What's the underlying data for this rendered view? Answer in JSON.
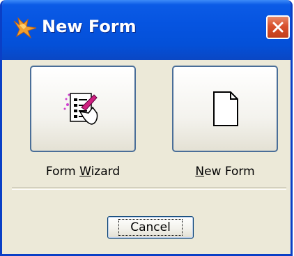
{
  "window": {
    "title": "New Form"
  },
  "options": {
    "wizard": {
      "prefix": "Form ",
      "accel": "W",
      "suffix": "izard"
    },
    "newform": {
      "prefix": "",
      "accel": "N",
      "suffix": "ew Form"
    }
  },
  "footer": {
    "cancel_label": "Cancel"
  },
  "icons": {
    "title": "fox-logo-icon",
    "close": "close-icon",
    "wizard": "form-wizard-icon",
    "newform": "blank-page-icon"
  },
  "colors": {
    "titlebar": "#0654e0",
    "close": "#d8502c",
    "dialog_bg": "#ece9d8",
    "button_border": "#4a6e98"
  }
}
